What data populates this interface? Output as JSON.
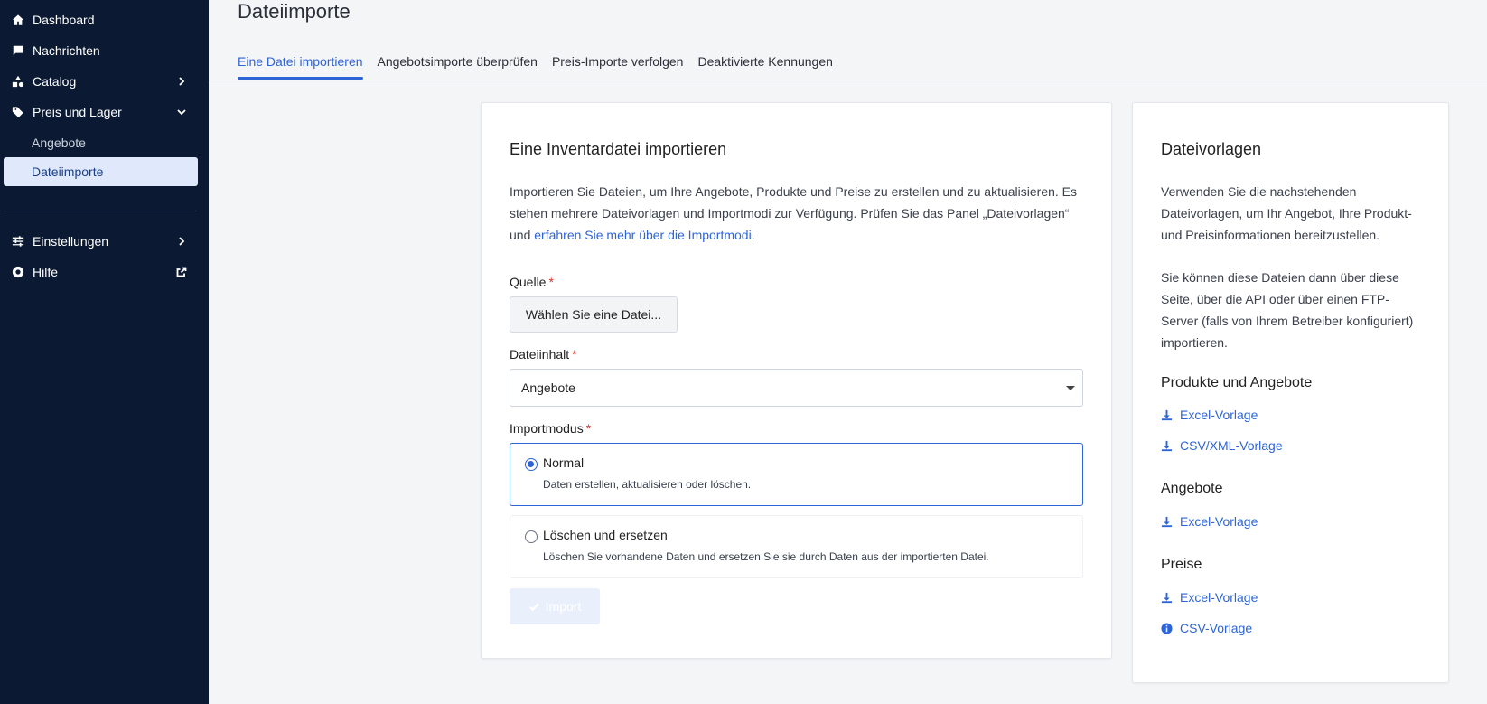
{
  "sidebar": {
    "items": [
      {
        "label": "Dashboard",
        "icon": "home-icon"
      },
      {
        "label": "Nachrichten",
        "icon": "message-icon"
      },
      {
        "label": "Catalog",
        "icon": "shapes-icon"
      },
      {
        "label": "Preis und Lager",
        "icon": "tag-icon"
      },
      {
        "label": "Einstellungen",
        "icon": "sliders-icon"
      },
      {
        "label": "Hilfe",
        "icon": "lifebuoy-icon"
      }
    ],
    "sub_items": [
      {
        "label": "Angebote"
      },
      {
        "label": "Dateiimporte",
        "active": true
      }
    ]
  },
  "header": {
    "title": "Dateiimporte"
  },
  "tabs": [
    {
      "label": "Eine Datei importieren",
      "active": true
    },
    {
      "label": "Angebotsimporte überprüfen"
    },
    {
      "label": "Preis-Importe verfolgen"
    },
    {
      "label": "Deaktivierte Kennungen"
    }
  ],
  "import_card": {
    "title": "Eine Inventardatei importieren",
    "desc_text": "Importieren Sie Dateien, um Ihre Angebote, Produkte und Preise zu erstellen und zu aktualisieren. Es stehen mehrere Dateivorlagen und Importmodi zur Verfügung. Prüfen Sie das Panel „Dateivorlagen“ und ",
    "desc_link": "erfahren Sie mehr über die Importmodi",
    "desc_end": ".",
    "source_label": "Quelle",
    "file_button": "Wählen Sie eine Datei...",
    "content_label": "Dateiinhalt",
    "content_value": "Angebote",
    "mode_label": "Importmodus",
    "modes": [
      {
        "title": "Normal",
        "subtitle": "Daten erstellen, aktualisieren oder löschen.",
        "selected": true
      },
      {
        "title": "Löschen und ersetzen",
        "subtitle": "Löschen Sie vorhandene Daten und ersetzen Sie sie durch Daten aus der importierten Datei.",
        "selected": false
      }
    ],
    "import_button": "Import",
    "required_mark": "*"
  },
  "templates_card": {
    "title": "Dateivorlagen",
    "para1": "Verwenden Sie die nachstehenden Dateivorlagen, um Ihr Angebot, Ihre Produkt- und Preisinformationen bereitzustellen.",
    "para2": "Sie können diese Dateien dann über diese Seite, über die API oder über einen FTP-Server (falls von Ihrem Betreiber konfiguriert) importieren.",
    "sections": [
      {
        "title": "Produkte und Angebote",
        "links": [
          {
            "label": "Excel-Vorlage",
            "icon": "download-icon"
          },
          {
            "label": "CSV/XML-Vorlage",
            "icon": "download-icon"
          }
        ]
      },
      {
        "title": "Angebote",
        "links": [
          {
            "label": "Excel-Vorlage",
            "icon": "download-icon"
          }
        ]
      },
      {
        "title": "Preise",
        "links": [
          {
            "label": "Excel-Vorlage",
            "icon": "download-icon"
          },
          {
            "label": "CSV-Vorlage",
            "icon": "info-icon"
          }
        ]
      }
    ]
  },
  "colors": {
    "sidebar_bg": "#0b1a32",
    "accent": "#2d64d6",
    "active_sub_bg": "#dfe9fb",
    "required": "#d9332b"
  }
}
